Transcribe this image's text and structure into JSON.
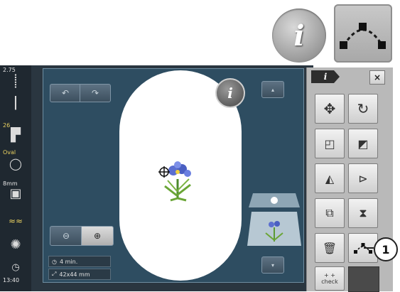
{
  "sidebar": {
    "stitch_width": "2.75",
    "stitch_length": "26",
    "hoop_name": "Oval",
    "tension_value": "8mm",
    "time": "13:40"
  },
  "status": {
    "duration": "4 min.",
    "design_size": "42x44 mm"
  },
  "info_glyph": "i",
  "panel": {
    "tab_label": "i",
    "close_label": "×",
    "check_label": "check",
    "check_arrows": "+ +"
  },
  "callout_number": "1",
  "icons": {
    "move": "move-arrows-icon",
    "rotate": "rotate-icon",
    "resize": "resize-icon",
    "group": "group-icon",
    "mirror_h": "mirror-horizontal-icon",
    "mirror_v": "mirror-vertical-icon",
    "duplicate": "duplicate-icon",
    "stitch_type": "stitch-type-icon",
    "delete": "trash-icon",
    "curve": "curve-icon"
  }
}
